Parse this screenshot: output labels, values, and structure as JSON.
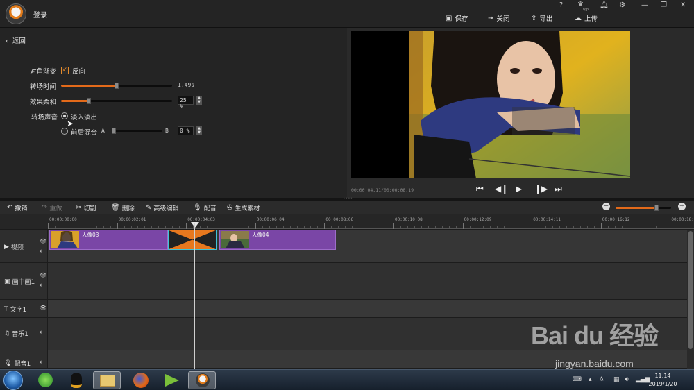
{
  "header": {
    "login_label": "登录",
    "help_icon": "?",
    "vip_label": "VIP",
    "save_label": "保存",
    "close_label": "关闭",
    "export_label": "导出",
    "upload_label": "上传"
  },
  "left_panel": {
    "back_label": "返回",
    "diagonal_label": "对角渐变",
    "reverse_label": "反向",
    "reverse_checked": true,
    "duration_label": "转场时间",
    "duration_value": "1.49s",
    "duration_fraction": 0.5,
    "softness_label": "效果柔和",
    "softness_value": "25 %",
    "softness_fraction": 0.25,
    "audio_label": "转场声音",
    "fade_label": "淡入淡出",
    "mix_label": "前后混合",
    "mix_a": "A",
    "mix_b": "B",
    "mix_value": "0 %"
  },
  "preview": {
    "timecode": "00:00:04.11/00:00:08.19"
  },
  "edit_toolbar": {
    "undo": "撤销",
    "redo": "重做",
    "cut": "切割",
    "delete": "删除",
    "advanced": "高级编辑",
    "dub": "配音",
    "generate": "生成素材",
    "zoom_fraction": 0.9
  },
  "timeline": {
    "ruler_labels": [
      "00:00:00:00",
      "00:00:02:01",
      "00:00:04:03",
      "00:00:06:04",
      "00:00:08:06",
      "00:00:10:08",
      "00:00:12:09",
      "00:00:14:11",
      "00:00:16:12",
      "00:00:18:1"
    ],
    "tracks": {
      "video": "视频",
      "pip": "画中画1",
      "text": "文字1",
      "music": "音乐1",
      "voice": "配音1"
    },
    "clip1_label": "人像03",
    "clip2_label": "人像04"
  },
  "taskbar": {
    "time": "11:14",
    "date": "2019/1/20"
  },
  "watermark": {
    "brand": "Bai du 经验",
    "url": "jingyan.baidu.com"
  },
  "colors": {
    "accent": "#e36a1a",
    "clip": "#7a46a6",
    "transition": "#e8781e"
  }
}
